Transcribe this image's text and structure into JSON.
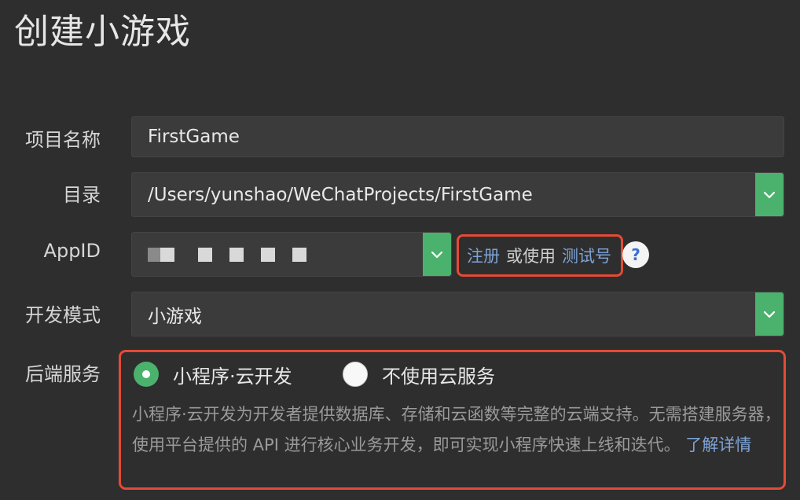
{
  "window": {
    "title": "创建小游戏"
  },
  "form": {
    "project_name": {
      "label": "项目名称",
      "value": "FirstGame"
    },
    "directory": {
      "label": "目录",
      "value": "/Users/yunshao/WeChatProjects/FirstGame"
    },
    "appid": {
      "label": "AppID",
      "register_link": "注册",
      "or_use_text": "或使用",
      "test_account_link": "测试号",
      "help_label": "?"
    },
    "dev_mode": {
      "label": "开发模式",
      "value": "小游戏"
    },
    "backend": {
      "label": "后端服务",
      "options": [
        {
          "label": "小程序·云开发",
          "selected": true
        },
        {
          "label": "不使用云服务",
          "selected": false
        }
      ],
      "description": "小程序·云开发为开发者提供数据库、存储和云函数等完整的云端支持。无需搭建服务器，使用平台提供的 API 进行核心业务开发，即可实现小程序快速上线和迭代。",
      "learn_more_link": "了解详情"
    }
  },
  "colors": {
    "background": "#2e2e2e",
    "accent_green": "#4ab26d",
    "link_blue": "#7ea3d6",
    "highlight_red": "#e34b36"
  },
  "icons": {
    "select_arrow": "chevron-down-icon",
    "help": "question-mark-icon"
  }
}
